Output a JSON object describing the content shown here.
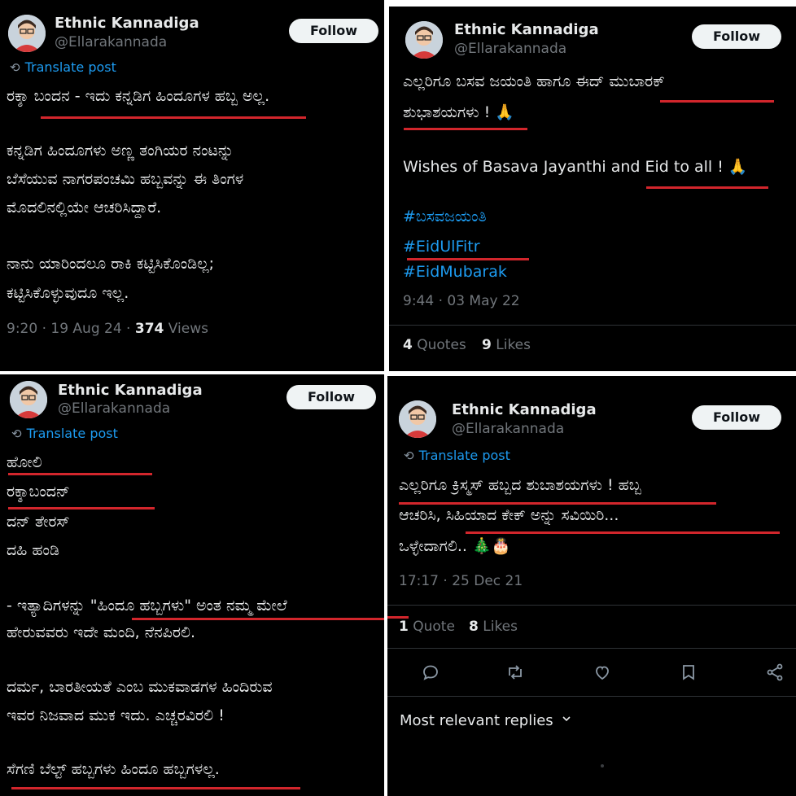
{
  "author": {
    "name": "Ethnic Kannadiga",
    "handle": "@Ellarakannada"
  },
  "follow_label": "Follow",
  "translate_label": "Translate post",
  "post1": {
    "lines": [
      "ರಕ್ಶಾ ಬಂದನ - ಇದು ಕನ್ನಡಿಗ ಹಿಂದೂಗಳ ಹಬ್ಬ ಅಲ್ಲ.",
      "ಕನ್ನಡಿಗ ಹಿಂದೂಗಳು ಅಣ್ಣ ತಂಗಿಯರ ನಂಟನ್ನು",
      "ಬೆಸೆಯುವ ನಾಗರಪಂಚಮಿ ಹಬ್ಬವನ್ನು ಈ ತಿಂಗಳ",
      "ಮೊದಲಿನಲ್ಲಿಯೇ ಆಚರಿಸಿದ್ದಾರೆ.",
      "ನಾನು ಯಾರಿಂದಲೂ ರಾಕಿ ಕಟ್ಟಿಸಿಕೊಂಡಿಲ್ಲ;",
      "ಕಟ್ಟಿಸಿಕೊಳ್ಳುವುದೂ ಇಲ್ಲ."
    ],
    "time": "9:20 · 19 Aug 24 · ",
    "views_count": "374",
    "views_label": " Views"
  },
  "post2": {
    "lines": [
      "ಎಲ್ಲರಿಗೂ ಬಸವ ಜಯಂತಿ ಹಾಗೂ ಈದ್ ಮುಬಾರಕ್",
      "ಶುಭಾಶಯಗಳು ! 🙏",
      "Wishes of Basava Jayanthi and Eid to all ! 🙏"
    ],
    "hashtags": [
      "#ಬಸವಜಯಂತಿ",
      "#EidUlFitr",
      "#EidMubarak"
    ],
    "time": "9:44 · 03 May 22",
    "quotes_count": "4",
    "quotes_label": " Quotes",
    "likes_count": "9",
    "likes_label": " Likes"
  },
  "post3": {
    "lines": [
      "ಹೋಲಿ",
      "ರಕ್ಶಾಬಂದನ್",
      "ದನ್ ತೇರಸ್",
      "ದಹಿ ಹಂಡಿ",
      "- ಇತ್ಯಾದಿಗಳನ್ನು \"ಹಿಂದೂ ಹಬ್ಬಗಳು\" ಅಂತ ನಮ್ಮ ಮೇಲೆ",
      "ಹೇರುವವರು ಇದೇ ಮಂದಿ, ನೆನಪಿರಲಿ.",
      "ದರ್ಮ, ಬಾರತೀಯತೆ ಎಂಬ ಮುಕವಾಡಗಳ ಹಿಂದಿರುವ",
      "ಇವರ ನಿಜವಾದ ಮುಕ ಇದು. ಎಚ್ಚರವಿರಲಿ !",
      "ಸೆಗಣಿ ಬೆಲ್ಟ್ ಹಬ್ಬಗಳು ಹಿಂದೂ ಹಬ್ಬಗಳಲ್ಲ."
    ]
  },
  "post4": {
    "lines": [
      "ಎಲ್ಲರಿಗೂ ಕ್ರಿಸ್ಮಸ್ ಹಬ್ಬದ ಶುಬಾಶಯಗಳು ! ಹಬ್ಬ",
      "ಆಚರಿಸಿ, ಸಿಹಿಯಾದ ಕೇಕ್ ಅನ್ನು ಸವಿಯಿರಿ...",
      "ಒಳ್ಳೇದಾಗಲಿ.. 🎄🎂"
    ],
    "time": "17:17 · 25 Dec 21",
    "quotes_count": "1",
    "quotes_label": " Quote",
    "likes_count": "8",
    "likes_label": " Likes",
    "most_relevant": "Most relevant replies"
  },
  "icons": [
    "translate-icon",
    "reply-icon",
    "retweet-icon",
    "like-icon",
    "bookmark-icon",
    "share-icon",
    "chevron-down-icon"
  ],
  "colors": {
    "background": "#000000",
    "accent": "#1d9bf0",
    "underline": "#d2262c",
    "follow_bg": "#eff3f4"
  }
}
